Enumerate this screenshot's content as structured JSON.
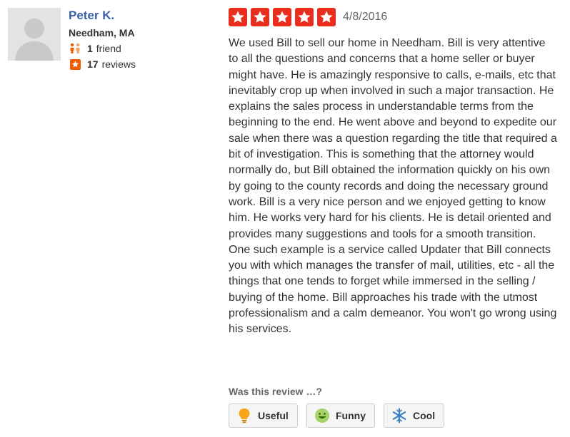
{
  "user": {
    "name": "Peter K.",
    "location": "Needham, MA",
    "friends_count": "1",
    "friends_label": "friend",
    "reviews_count": "17",
    "reviews_label": "reviews"
  },
  "review": {
    "rating": 5,
    "date": "4/8/2016",
    "text": "We used Bill to sell our home in Needham. Bill is very attentive to all the questions and concerns that a home seller or buyer might have. He is amazingly responsive to calls, e-mails, etc that inevitably crop up when involved in such a major transaction. He explains the sales process in understandable terms from the beginning to the end. He went above and beyond to expedite our sale when there was a question regarding the title that required a bit of investigation. This is something that the attorney would normally do, but Bill obtained the information quickly on his own by going to the county records and doing the necessary ground work. Bill is a very nice person and we enjoyed getting to know him. He works very hard for his clients. He is detail oriented and provides many suggestions and tools for a smooth transition. One such example is a service called Updater that Bill connects you with which manages the transfer of mail, utilities, etc - all the things that one tends to forget while immersed in the selling / buying of the home. Bill approaches his trade with the utmost professionalism and a calm demeanor. You won't go wrong using his services."
  },
  "votes": {
    "prompt": "Was this review …?",
    "useful_label": "Useful",
    "funny_label": "Funny",
    "cool_label": "Cool"
  },
  "colors": {
    "star_red": "#e92e1d",
    "name_blue": "#3a5fa8",
    "friend_orange": "#f15c00"
  },
  "icons": {
    "avatar": "default-avatar-silhouette",
    "friends": "friends-icon",
    "reviews": "review-star-icon",
    "useful": "lightbulb-icon",
    "funny": "smiley-icon",
    "cool": "snowflake-icon"
  }
}
